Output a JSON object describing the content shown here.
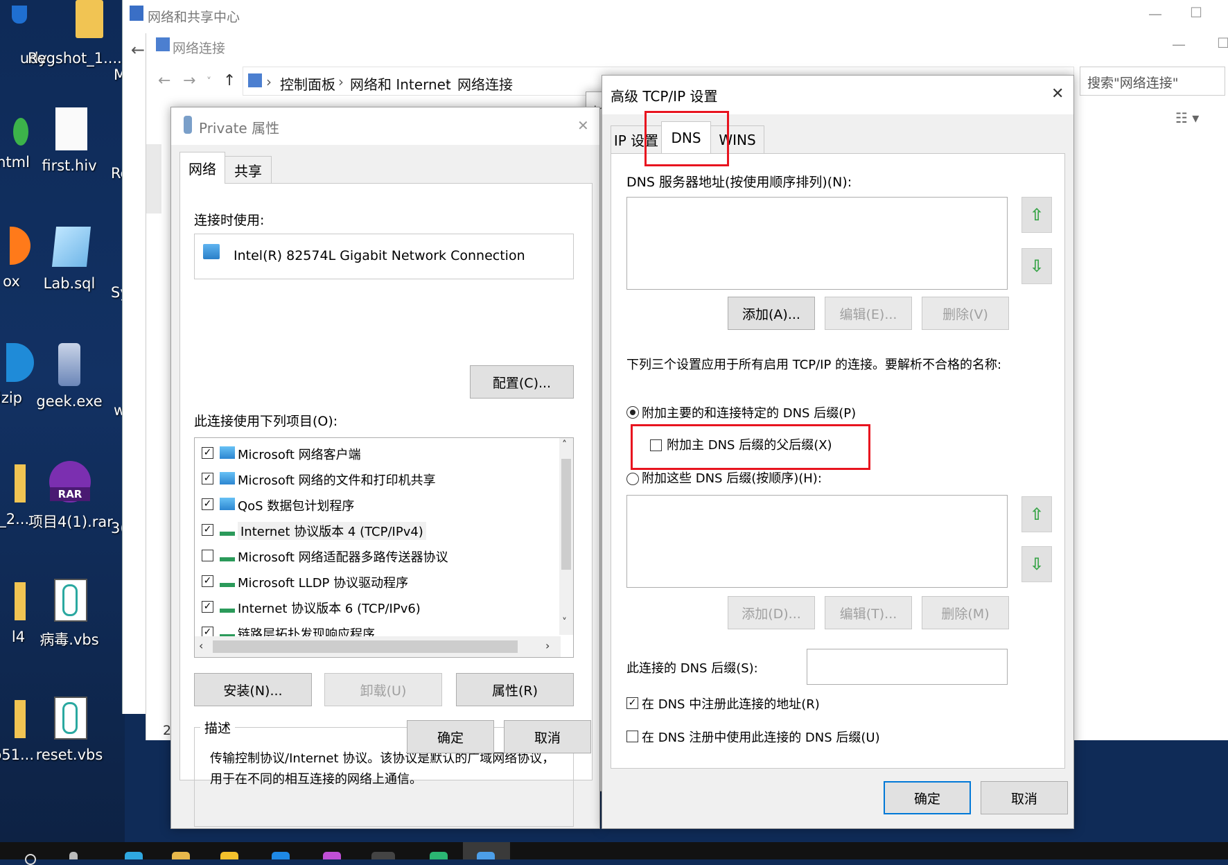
{
  "desktop": {
    "icons": [
      {
        "label": "udy"
      },
      {
        "label": "Regshot_1...."
      },
      {
        "label": "ntml"
      },
      {
        "label": "first.hiv"
      },
      {
        "label": "ox"
      },
      {
        "label": "Lab.sql"
      },
      {
        "label": "izip"
      },
      {
        "label": "geek.exe"
      },
      {
        "label": "x_2..."
      },
      {
        "label": "项目4(1).rar"
      },
      {
        "label": "l4"
      },
      {
        "label": "病毒.vbs"
      },
      {
        "label": "b51..."
      },
      {
        "label": "reset.vbs"
      }
    ],
    "cut_labels": [
      "M",
      "Re",
      "Sy",
      "w",
      "3("
    ]
  },
  "network_center": {
    "title": "网络和共享中心"
  },
  "network_connections": {
    "title": "网络连接",
    "breadcrumb": [
      "控制面板",
      "网络和 Internet",
      "网络连接"
    ],
    "search_placeholder": "搜索\"网络连接\"",
    "status_count": "2"
  },
  "private_props": {
    "title": "Private 属性",
    "tabs": [
      "网络",
      "共享"
    ],
    "connect_using_label": "连接时使用:",
    "adapter": "Intel(R) 82574L Gigabit Network Connection",
    "configure_button": "配置(C)...",
    "items_label": "此连接使用下列项目(O):",
    "items": [
      {
        "label": "Microsoft 网络客户端",
        "checked": true
      },
      {
        "label": "Microsoft 网络的文件和打印机共享",
        "checked": true
      },
      {
        "label": "QoS 数据包计划程序",
        "checked": true
      },
      {
        "label": "Internet 协议版本 4 (TCP/IPv4)",
        "checked": true
      },
      {
        "label": "Microsoft 网络适配器多路传送器协议",
        "checked": false
      },
      {
        "label": "Microsoft LLDP 协议驱动程序",
        "checked": true
      },
      {
        "label": "Internet 协议版本 6 (TCP/IPv6)",
        "checked": true
      },
      {
        "label": "链路层拓扑发现响应程序",
        "checked": true
      }
    ],
    "install_button": "安装(N)...",
    "uninstall_button": "卸载(U)",
    "properties_button": "属性(R)",
    "description_label": "描述",
    "description": "传输控制协议/Internet 协议。该协议是默认的广域网络协议，用于在不同的相互连接的网络上通信。",
    "ok_button": "确定",
    "cancel_button": "取消"
  },
  "ipv4_partial": {
    "title_fragment": "Ir"
  },
  "advanced_tcpip": {
    "title": "高级 TCP/IP 设置",
    "tabs": [
      "IP 设置",
      "DNS",
      "WINS"
    ],
    "active_tab": "DNS",
    "dns_servers_label": "DNS 服务器地址(按使用顺序排列)(N):",
    "add_button": "添加(A)...",
    "edit_button": "编辑(E)...",
    "remove_button": "删除(V)",
    "apply_note": "下列三个设置应用于所有启用 TCP/IP 的连接。要解析不合格的名称:",
    "radio_primary": "附加主要的和连接特定的 DNS 后缀(P)",
    "checkbox_parent": "附加主 DNS 后缀的父后缀(X)",
    "radio_these": "附加这些 DNS 后缀(按顺序)(H):",
    "add2_button": "添加(D)...",
    "edit2_button": "编辑(T)...",
    "remove2_button": "删除(M)",
    "conn_suffix_label": "此连接的 DNS 后缀(S):",
    "conn_suffix_value": "",
    "register_label": "在 DNS 中注册此连接的地址(R)",
    "register_checked": true,
    "use_suffix_label": "在 DNS 注册中使用此连接的 DNS 后缀(U)",
    "use_suffix_checked": false,
    "ok_button": "确定",
    "cancel_button": "取消"
  },
  "colors": {
    "highlight": "#e8141f",
    "accent": "#0078d7",
    "arrow_green": "#3aa54a"
  }
}
